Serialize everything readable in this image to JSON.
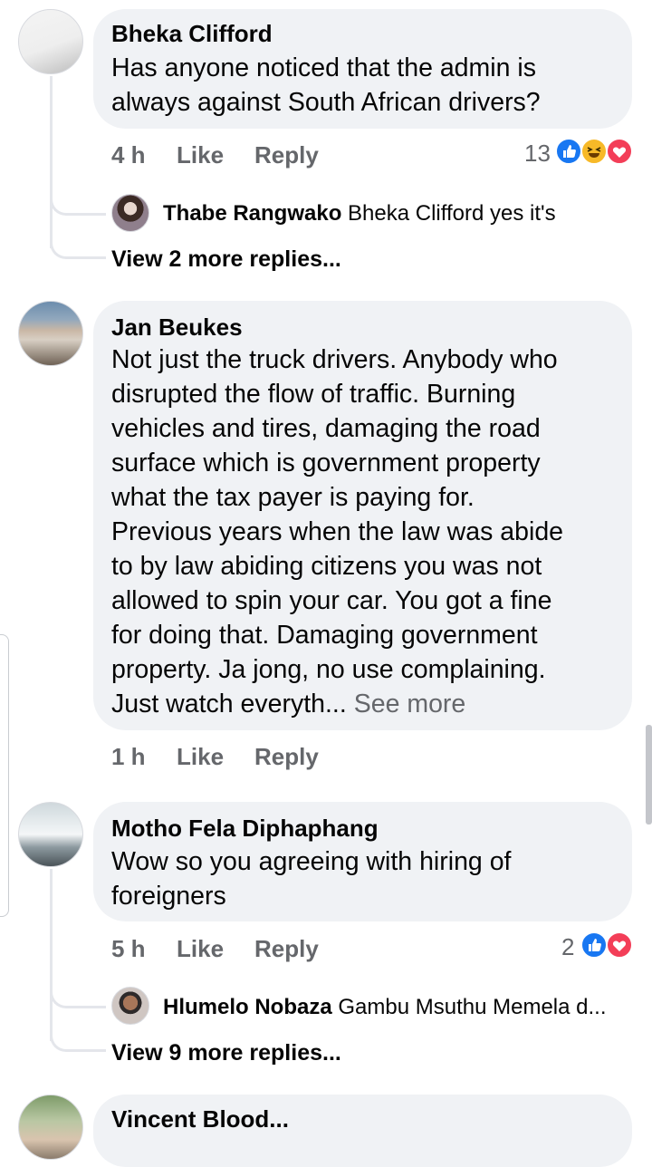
{
  "comments": [
    {
      "author": "Bheka Clifford",
      "text_lines": [
        "Has anyone noticed that the admin is",
        "always against South African drivers?"
      ],
      "time": "4 h",
      "like_label": "Like",
      "reply_label": "Reply",
      "reaction_count": "13",
      "reactions": [
        "like-reaction-icon",
        "haha-reaction-icon",
        "love-reaction-icon"
      ],
      "reply_preview": {
        "author": "Thabe Rangwako",
        "text": "Bheka Clifford yes it's"
      },
      "view_more": "View 2 more replies..."
    },
    {
      "author": "Jan Beukes",
      "text_lines": [
        "Not just the truck drivers. Anybody who",
        "disrupted the flow of traffic. Burning",
        "vehicles and tires, damaging the road",
        "surface which is government property",
        "what the tax payer is paying for.",
        "Previous years when the law was abide",
        "to by law abiding citizens you was not",
        "allowed to spin your car. You got a fine",
        "for doing that. Damaging government",
        "property. Ja jong, no use complaining."
      ],
      "last_line": "Just watch everyth...",
      "see_more": "See more",
      "time": "1 h",
      "like_label": "Like",
      "reply_label": "Reply"
    },
    {
      "author": "Motho Fela Diphaphang",
      "text_lines": [
        "Wow so you agreeing with hiring of",
        "foreigners"
      ],
      "time": "5 h",
      "like_label": "Like",
      "reply_label": "Reply",
      "reaction_count": "2",
      "reactions": [
        "like-reaction-icon",
        "love-reaction-icon"
      ],
      "reply_preview": {
        "author": "Hlumelo Nobaza",
        "text": "Gambu Msuthu Memela d..."
      },
      "view_more": "View 9 more replies..."
    },
    {
      "author": "Vincent Blood..."
    }
  ],
  "colors": {
    "bubble": "#f0f2f5",
    "meta": "#65676b",
    "like_blue": "#1877f2",
    "love_red": "#f33e58",
    "haha_yellow": "#f7b928"
  }
}
